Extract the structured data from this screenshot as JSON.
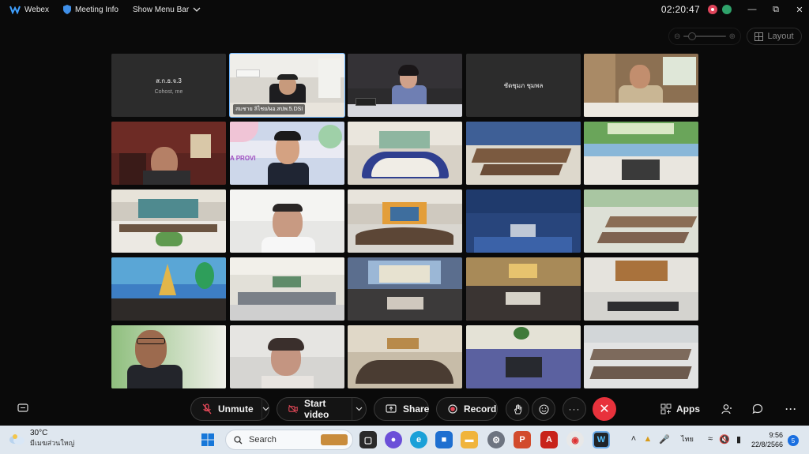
{
  "titlebar": {
    "app_name": "Webex",
    "meeting_info": "Meeting Info",
    "show_menu_bar": "Show Menu Bar",
    "clock": "02:20:47"
  },
  "layout_button": "Layout",
  "tiles": [
    {
      "type": "plain",
      "name": "ส.ก.ธ.จ.3",
      "sub": "Cohost, me"
    },
    {
      "type": "video",
      "name": "สมชาย ลิไชย/ผอ.สปพ.5.DSI",
      "active": true
    },
    {
      "type": "video",
      "name": ""
    },
    {
      "type": "plain",
      "name": "ชัดชุมภ ชุมพล",
      "sub": ""
    },
    {
      "type": "video",
      "name": ""
    }
  ],
  "controls": {
    "unmute": "Unmute",
    "start_video": "Start video",
    "share": "Share",
    "record": "Record",
    "apps": "Apps"
  },
  "taskbar": {
    "temp": "30°C",
    "weather_text": "มีเมฆส่วนใหญ่",
    "search_placeholder": "Search",
    "time": "9:56",
    "date": "22/8/2566",
    "lang": "ไทย",
    "notifications": "5"
  },
  "colors": {
    "accent": "#6fb6ff",
    "end_call": "#e8323c",
    "taskbar": "#dfe7ef"
  }
}
